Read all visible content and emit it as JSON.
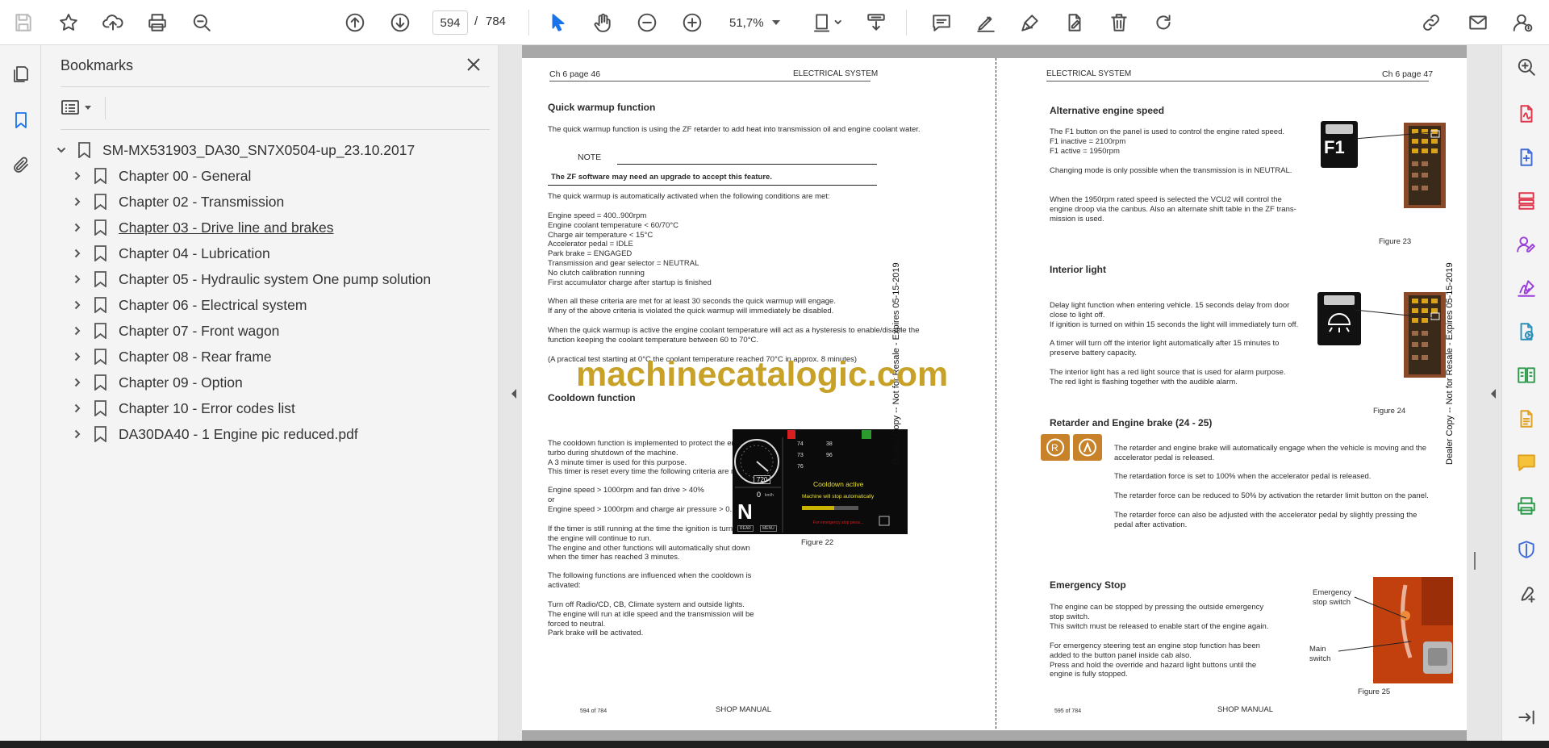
{
  "toolbar": {
    "page_current": "594",
    "page_separator": "/",
    "page_total": "784",
    "zoom": "51,7%"
  },
  "bookmarks": {
    "title": "Bookmarks",
    "root": "SM-MX531903_DA30_SN7X0504-up_23.10.2017",
    "items": [
      {
        "label": "Chapter 00 - General"
      },
      {
        "label": "Chapter 02 - Transmission"
      },
      {
        "label": "Chapter 03 - Drive line and brakes"
      },
      {
        "label": "Chapter 04 - Lubrication"
      },
      {
        "label": "Chapter 05 - Hydraulic system One pump solution"
      },
      {
        "label": "Chapter 06 - Electrical system"
      },
      {
        "label": "Chapter 07 - Front wagon"
      },
      {
        "label": "Chapter 08 - Rear frame"
      },
      {
        "label": "Chapter 09 - Option"
      },
      {
        "label": "Chapter 10 - Error codes list"
      },
      {
        "label": "DA30DA40 - 1 Engine pic reduced.pdf"
      }
    ]
  },
  "left_page": {
    "header_left": "Ch 6 page 46",
    "header_right": "ELECTRICAL SYSTEM",
    "title1": "Quick warmup function",
    "intro": "The quick warmup function is using the ZF retarder to add heat into transmission oil and engine coolant water.",
    "note_label": "NOTE",
    "note_text": "The ZF software may need an upgrade to accept this feature.",
    "para1": "The quick warmup is automatically activated when the following conditions are met:",
    "conditions": "Engine speed = 400..900rpm\nEngine coolant temperature < 60/70°C\nCharge air temperature < 15°C\nAccelerator pedal = IDLE\nPark brake = ENGAGED\nTransmission and gear selector = NEUTRAL\nNo clutch calibration running\nFirst accumulator charge after startup is finished",
    "para2": "When all these criteria are met for at least 30 seconds the quick warmup will engage.\nIf any of the above criteria is violated the quick warmup will immediately be disabled.",
    "para3": "When the quick warmup is active the engine coolant temperature will act as a hysteresis to enable/disable the\nfunction keeping the coolant temperature between 60 to 70°C.",
    "para4": "(A practical test starting at 0°C the coolant temperature reached 70°C in approx. 8 minutes)",
    "title2": "Cooldown function",
    "cool1": "The cooldown function is implemented to protect the engine\nturbo during shutdown of the machine.\nA 3 minute timer is used for this purpose.\nThis timer is reset every time the following criteria are met:",
    "cool2": "Engine speed > 1000rpm and fan drive > 40%\nor\nEngine speed > 1000rpm and charge air pressure > 0.14bar",
    "cool3": "If the timer is still running at the time the ignition is turned off\nthe engine will continue to run.\nThe engine and other functions will automatically shut down\nwhen the timer has reached 3 minutes.",
    "cool4": "The following functions are influenced when the cooldown is\nactivated:",
    "cool5": "Turn off Radio/CD, CB, Climate system and outside lights.\nThe engine will run at idle speed and the transmission will be\nforced to neutral.\nPark brake will be activated.",
    "fig22": "Figure 22",
    "screen": {
      "cooldown": "Cooldown active",
      "stop": "Machine will stop automatically",
      "gear": "N",
      "speed": "0",
      "speed_unit": "km/h",
      "rpm": "720",
      "v1": "74",
      "v2": "38",
      "v3": "73",
      "v4": "96",
      "v5": "76",
      "btn1": "REAR",
      "btn2": "MENU"
    },
    "footer_left": "594 of 784",
    "footer_center": "SHOP MANUAL"
  },
  "right_page": {
    "header_left": "ELECTRICAL SYSTEM",
    "header_right": "Ch 6 page 47",
    "title1": "Alternative engine speed",
    "alt1": "The F1 button on the panel is used to control the engine rated speed.\nF1 inactive = 2100rpm\nF1 active = 1950rpm",
    "alt2": "Changing mode is only possible when the transmission is in NEUTRAL.",
    "alt3": "When the 1950rpm rated speed is selected the VCU2 will control the\nengine droop via the canbus. Also an alternate shift table in the ZF trans-\nmission is used.",
    "f1_label": "F1",
    "fig23": "Figure 23",
    "title2": "Interior light",
    "int1": "Delay light function when entering vehicle. 15 seconds delay from door\nclose to light off.\nIf ignition is turned on within 15 seconds the light will immediately turn off.",
    "int2": "A timer will turn off the interior light automatically after 15 minutes to\npreserve battery capacity.",
    "int3": "The interior light has a red light source that is used for alarm purpose.\nThe red light is flashing together with the audible alarm.",
    "fig24": "Figure 24",
    "title3": "Retarder and Engine brake (24 - 25)",
    "ret1": "The retarder and engine brake will automatically engage when the vehicle is moving and the\naccelerator pedal is released.",
    "ret2": "The retardation force is set to 100% when the accelerator pedal is released.",
    "ret3": "The retarder force can be reduced to 50% by activation the retarder limit button on the panel.",
    "ret4": "The retarder force can also be adjusted with the accelerator pedal by slightly pressing the\npedal after activation.",
    "title4": "Emergency Stop",
    "em1": "The engine can be stopped by pressing the outside emergency\nstop switch.\nThis switch must be released to enable start of the engine again.",
    "em2": "For emergency steering test an engine stop function has been\nadded to the button panel inside cab also.\nPress and hold the override and hazard light buttons until the\nengine is fully stopped.",
    "em_label1": "Emergency\nstop switch",
    "em_label2": "Main\nswitch",
    "fig25": "Figure 25",
    "footer_left": "595 of 784",
    "footer_center": "SHOP MANUAL"
  },
  "side_stamp": "Dealer Copy -- Not for Resale - Expires 05-15-2019",
  "watermark": "machinecatalogic.com"
}
